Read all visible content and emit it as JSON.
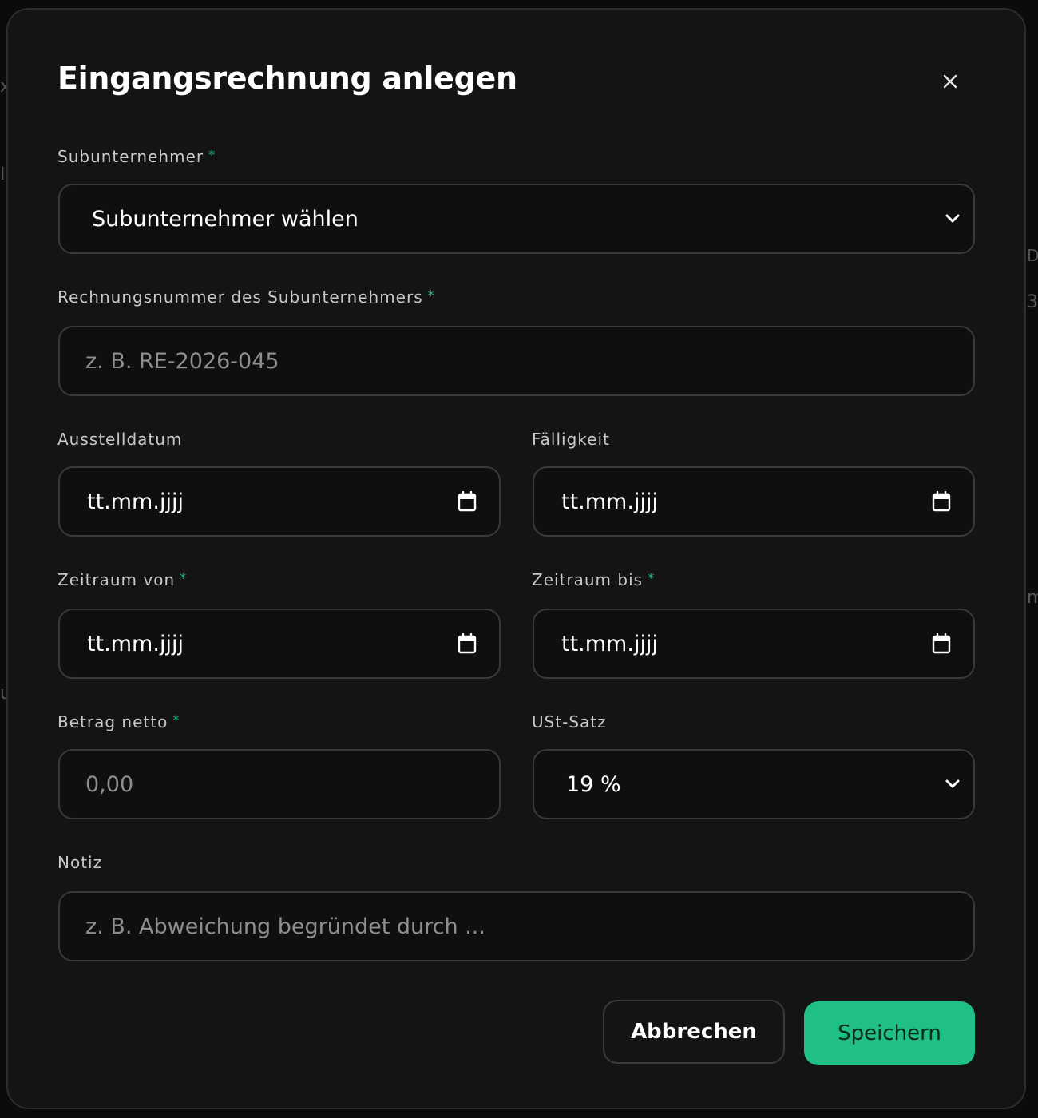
{
  "dialog": {
    "title": "Eingangsrechnung anlegen",
    "close_label": "×"
  },
  "fields": {
    "subunternehmer": {
      "label": "Subunternehmer",
      "required_mark": "*",
      "value": "Subunternehmer wählen"
    },
    "rechnungsnummer": {
      "label": "Rechnungsnummer des Subunternehmers",
      "required_mark": "*",
      "placeholder": "z. B. RE-2026-045"
    },
    "ausstelldatum": {
      "label": "Ausstelldatum",
      "value": "tt.mm.jjjj"
    },
    "faelligkeit": {
      "label": "Fälligkeit",
      "value": "tt.mm.jjjj"
    },
    "zeitraum_von": {
      "label": "Zeitraum von",
      "required_mark": "*",
      "value": "tt.mm.jjjj"
    },
    "zeitraum_bis": {
      "label": "Zeitraum bis",
      "required_mark": "*",
      "value": "tt.mm.jjjj"
    },
    "betrag_netto": {
      "label": "Betrag netto",
      "required_mark": "*",
      "placeholder": "0,00"
    },
    "ust_satz": {
      "label": "USt-Satz",
      "value": "19 %"
    },
    "notiz": {
      "label": "Notiz",
      "placeholder": "z. B. Abweichung begründet durch ..."
    }
  },
  "actions": {
    "cancel_label": "Abbrechen",
    "save_label": "Speichern"
  },
  "background": {
    "fragments": [
      "x",
      "I",
      "DN",
      "3",
      "m",
      "u"
    ]
  },
  "colors": {
    "accent": "#1fbf86",
    "modal_bg": "#141414",
    "field_bg": "#0f0f0f",
    "border": "#3a3a3a"
  }
}
